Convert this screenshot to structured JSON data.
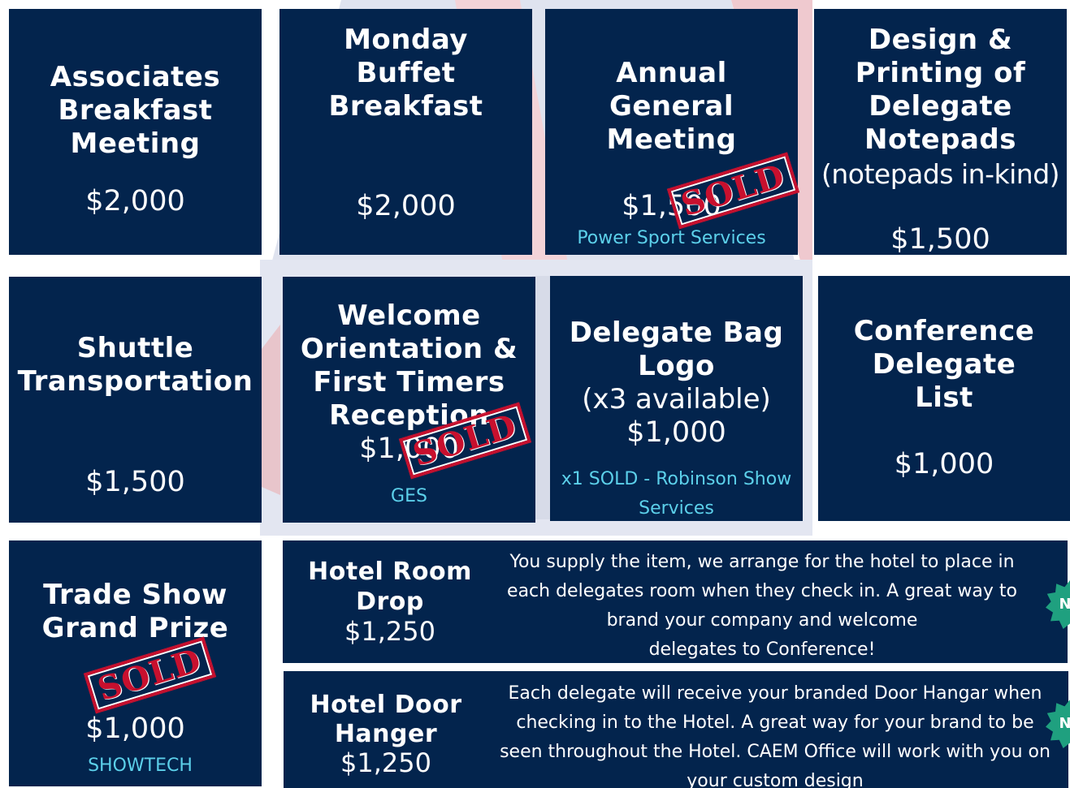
{
  "packages": [
    {
      "title_lines": [
        "Associates",
        "Breakfast",
        "Meeting"
      ],
      "price": "$2,000"
    },
    {
      "title_lines": [
        "Monday",
        "Buffet",
        "Breakfast"
      ],
      "price": "$2,000"
    },
    {
      "title_lines": [
        "Annual",
        "General",
        "Meeting"
      ],
      "price": "$1,500",
      "sponsor": "Power Sport Services",
      "sold": true
    },
    {
      "title_lines": [
        "Design &",
        "Printing of",
        "Delegate",
        "Notepads"
      ],
      "subtitle": "(notepads in-kind)",
      "price": "$1,500"
    },
    {
      "title_lines": [
        "Shuttle",
        "Transportation"
      ],
      "price": "$1,500"
    },
    {
      "title_lines": [
        "Welcome",
        "Orientation &",
        "First Timers",
        "Reception"
      ],
      "price": "$1,000",
      "sponsor": "GES",
      "sold": true
    },
    {
      "title_lines": [
        "Delegate Bag",
        "Logo"
      ],
      "subtitle": "(x3 available)",
      "price": "$1,000",
      "sponsor_lines": [
        "x1 SOLD - Robinson Show",
        "Services"
      ]
    },
    {
      "title_lines": [
        "Conference",
        "Delegate",
        "List"
      ],
      "price": "$1,000"
    },
    {
      "title_lines": [
        "Trade Show",
        "Grand Prize"
      ],
      "price": "$1,000",
      "sponsor": "SHOWTECH",
      "sold": true
    },
    {
      "title_lines": [
        "Hotel Room",
        "Drop"
      ],
      "price": "$1,250",
      "description_lines": [
        "You supply the item, we arrange for the hotel to place in",
        "each delegates room when they check in.  A great way to",
        "brand your company and welcome",
        "delegates to Conference!"
      ],
      "badge": "N"
    },
    {
      "title_lines": [
        "Hotel Door",
        "Hanger"
      ],
      "price": "$1,250",
      "description_lines": [
        "Each delegate will receive your branded Door Hangar when",
        "checking in to the Hotel. A great way for your brand to be",
        "seen throughout the Hotel. CAEM Office will work with you on",
        "your custom design"
      ],
      "badge": "N"
    }
  ],
  "stamp_text": "SOLD",
  "colors": {
    "card": "#03244d",
    "accent": "#5cd0ea",
    "stamp": "#c8102e",
    "badge": "#1fa07f"
  }
}
